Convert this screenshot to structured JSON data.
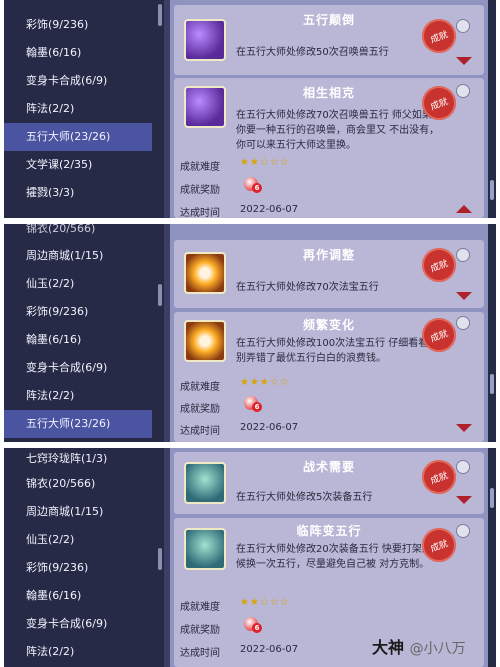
{
  "panel1": {
    "sidebar": [
      "彩饰(9/236)",
      "翰墨(6/16)",
      "变身卡合成(6/9)",
      "阵法(2/2)",
      "五行大师(23/26)",
      "文学课(2/35)",
      "攉戮(3/3)"
    ],
    "active_index": 4,
    "cards": [
      {
        "title": "五行颠倒",
        "desc": "在五行大师处修改50次召唤兽五行",
        "seal": "成就"
      },
      {
        "title": "相生相克",
        "desc": "在五行大师处修改70次召唤兽五行 师父如果跟你要一种五行的召唤兽，商会里又 不出没有，你可以来五行大师这里换。",
        "seal": "成就",
        "difficulty_label": "成就难度",
        "stars": "★★☆☆☆",
        "reward_label": "成就奖励",
        "reward_badge": "6",
        "date_label": "达成时间",
        "date": "2022-06-07"
      }
    ]
  },
  "panel2": {
    "sidebar": [
      "锦衣(20/566)",
      "周边商城(1/15)",
      "仙玉(2/2)",
      "彩饰(9/236)",
      "翰墨(6/16)",
      "变身卡合成(6/9)",
      "阵法(2/2)",
      "五行大师(23/26)"
    ],
    "active_index": 7,
    "cards": [
      {
        "title": "再作调整",
        "desc": "在五行大师处修改70次法宝五行",
        "seal": "成就"
      },
      {
        "title": "频繁变化",
        "desc": "在五行大师处修改100次法宝五行 仔细看看，别弄错了最优五行白白的浪费钱。",
        "seal": "成就",
        "difficulty_label": "成就难度",
        "stars": "★★★☆☆",
        "reward_label": "成就奖励",
        "reward_badge": "6",
        "date_label": "达成时间",
        "date": "2022-06-07"
      }
    ]
  },
  "panel3": {
    "sidebar": [
      "七窍玲珑阵(1/3)",
      "锦衣(20/566)",
      "周边商城(1/15)",
      "仙玉(2/2)",
      "彩饰(9/236)",
      "翰墨(6/16)",
      "变身卡合成(6/9)",
      "阵法(2/2)"
    ],
    "cards": [
      {
        "title": "战术需要",
        "desc": "在五行大师处修改5次装备五行",
        "seal": "成就"
      },
      {
        "title": "临阵变五行",
        "desc": "在五行大师处修改20次装备五行 快要打架的时候换一次五行，尽量避免自己被 对方克制。",
        "seal": "成就",
        "difficulty_label": "成就难度",
        "stars": "★★☆☆☆",
        "reward_label": "成就奖励",
        "reward_badge": "6",
        "date_label": "达成时间",
        "date": "2022-06-07"
      }
    ]
  },
  "watermark": {
    "brand": "大神",
    "user": "@小八万"
  },
  "colors": {
    "sidebar_bg": "#262a46",
    "active": "#4a54a0",
    "content_bg": "#8f93c0",
    "card_bg": "#b9b6d6",
    "seal": "#c8322f",
    "stars": "#d8a500"
  }
}
